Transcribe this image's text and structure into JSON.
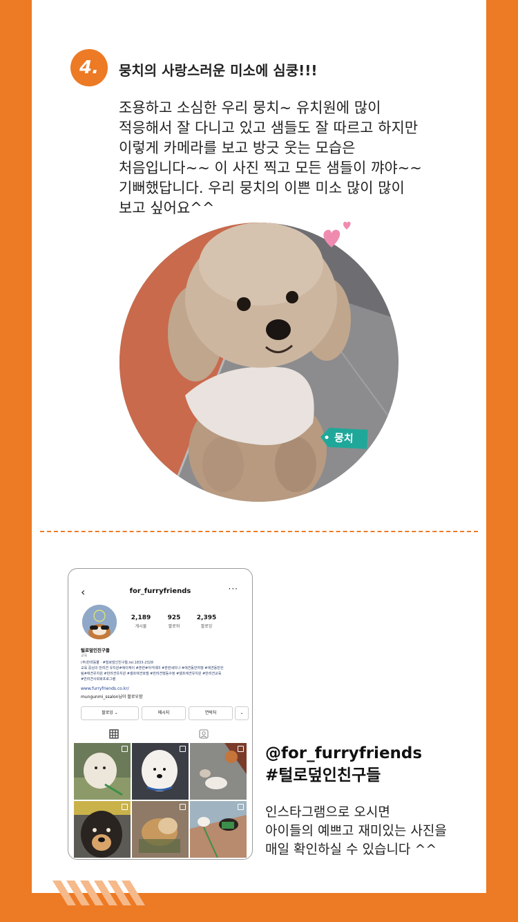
{
  "section": {
    "number": "4.",
    "title": "뭉치의 사랑스러운 미소에 심쿵!!!",
    "body_lines": [
      "조용하고 소심한 우리 뭉치~ 유치원에 많이",
      "적응해서 잘 다니고 있고 샘들도 잘 따르고 하지만",
      "이렇게 카메라를 보고 방긋 웃는 모습은",
      "처음입니다~~  이 사진 찍고 모든 샘들이 꺄야~~",
      "기뻐했답니다. 우리 뭉치의 이쁜 미소 많이 많이",
      "보고 싶어요^^"
    ],
    "dog_name_tag": "뭉치"
  },
  "instagram": {
    "back": "‹",
    "handle": "for_furryfriends",
    "more": "···",
    "stats": [
      {
        "value": "2,189",
        "label": "게시물"
      },
      {
        "value": "925",
        "label": "팔로워"
      },
      {
        "value": "2,395",
        "label": "팔로잉"
      }
    ],
    "bio_name": "털로덮인친구들",
    "bio_category": "교육",
    "bio_lines": [
      "(주)반려동물 · #털로덮인친구들,tel.1833-2328",
      "교육 중심의 반려견 유치원#에이케이 #훈련#아카데미 #훈련세미나 #애견동반여행 #애견동반한",
      "림#애견유치원 #반려견유치원 #셀프애견호텔 #반려견행동수정 #셀프애견유치원 #반려견교육",
      "#반려견사회화프로그램"
    ],
    "link": "www.furryfriends.co.kr/",
    "followed_by": "mungunmi_ssalon님이 팔로우함",
    "buttons": [
      "팔로잉 ⌄",
      "메시지",
      "연락처",
      "⌄"
    ],
    "accent": "#ED7A24"
  },
  "promo": {
    "handle": "@for_furryfriends",
    "hashtag": "#털로덮인친구들",
    "desc_lines": [
      "인스타그램으로 오시면",
      "아이들의 예쁘고 재미있는 사진을",
      "매일 확인하실 수 있습니다 ^^"
    ]
  },
  "colors": {
    "brand_orange": "#ED7A24",
    "tag_teal": "#1FA89A",
    "heart_pink": "#F08BB0"
  }
}
